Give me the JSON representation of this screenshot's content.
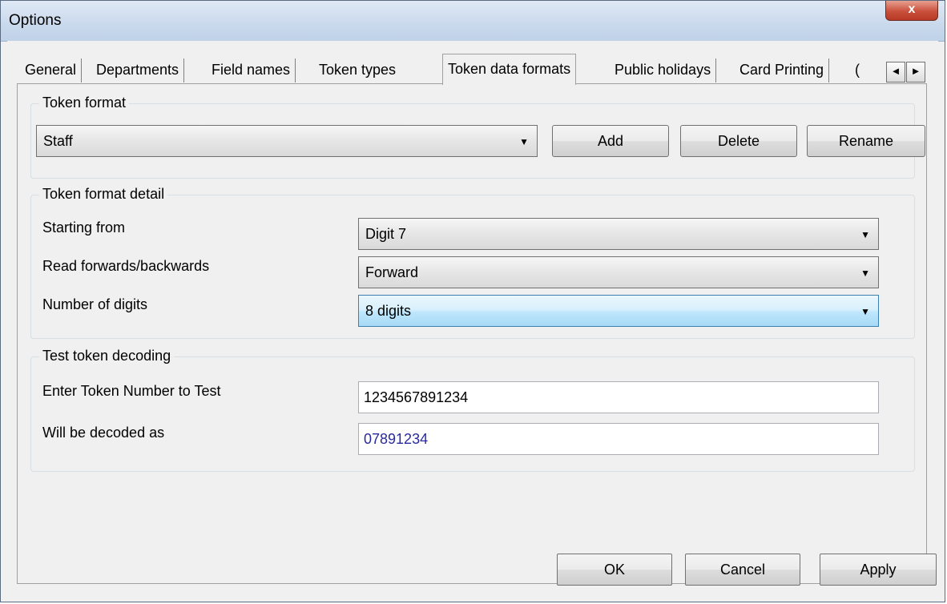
{
  "window": {
    "title": "Options",
    "close_glyph": "x"
  },
  "tabs": [
    {
      "label": "General"
    },
    {
      "label": "Departments"
    },
    {
      "label": "Field names"
    },
    {
      "label": "Token types"
    },
    {
      "label": "Token data formats"
    },
    {
      "label": "Public holidays"
    },
    {
      "label": "Card Printing"
    },
    {
      "label": "("
    }
  ],
  "tab_scroll": {
    "left": "◄",
    "right": "►"
  },
  "token_format": {
    "group_title": "Token format",
    "selected": "Staff",
    "add_label": "Add",
    "delete_label": "Delete",
    "rename_label": "Rename"
  },
  "token_format_detail": {
    "group_title": "Token format detail",
    "starting_from": {
      "label": "Starting from",
      "value": "Digit 7"
    },
    "read_direction": {
      "label": "Read forwards/backwards",
      "value": "Forward"
    },
    "number_of_digits": {
      "label": "Number of digits",
      "value": "8 digits"
    }
  },
  "test_decoding": {
    "group_title": "Test token decoding",
    "enter_label": "Enter Token Number to Test",
    "enter_value": "1234567891234",
    "decoded_label": "Will be decoded as",
    "decoded_value": "07891234"
  },
  "footer": {
    "ok_label": "OK",
    "cancel_label": "Cancel",
    "apply_label": "Apply"
  },
  "dropdown_arrow": "▼"
}
